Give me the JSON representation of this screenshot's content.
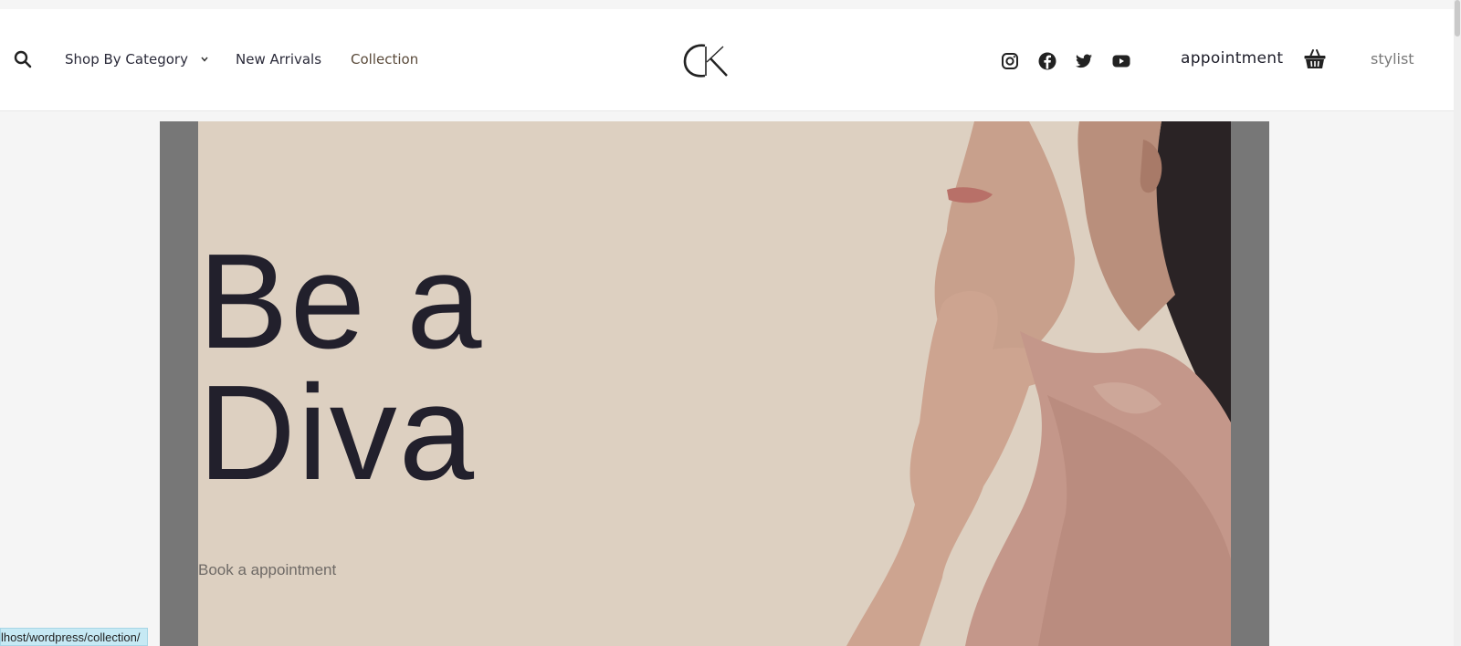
{
  "header": {
    "nav": {
      "shop_by_category": "Shop By Category",
      "new_arrivals": "New Arrivals",
      "collection": "Collection"
    },
    "logo_text": "CK",
    "social_icons": [
      "instagram-icon",
      "facebook-icon",
      "twitter-icon",
      "youtube-icon"
    ],
    "appointment_label": "appointment",
    "stylist_label": "stylist"
  },
  "hero": {
    "title_line1": "Be a",
    "title_line2": "Diva",
    "cta_link": "Book a appointment",
    "background_color": "#ddd0c1",
    "text_color": "#22202c"
  },
  "status_bar": {
    "url": "lhost/wordpress/collection/"
  }
}
